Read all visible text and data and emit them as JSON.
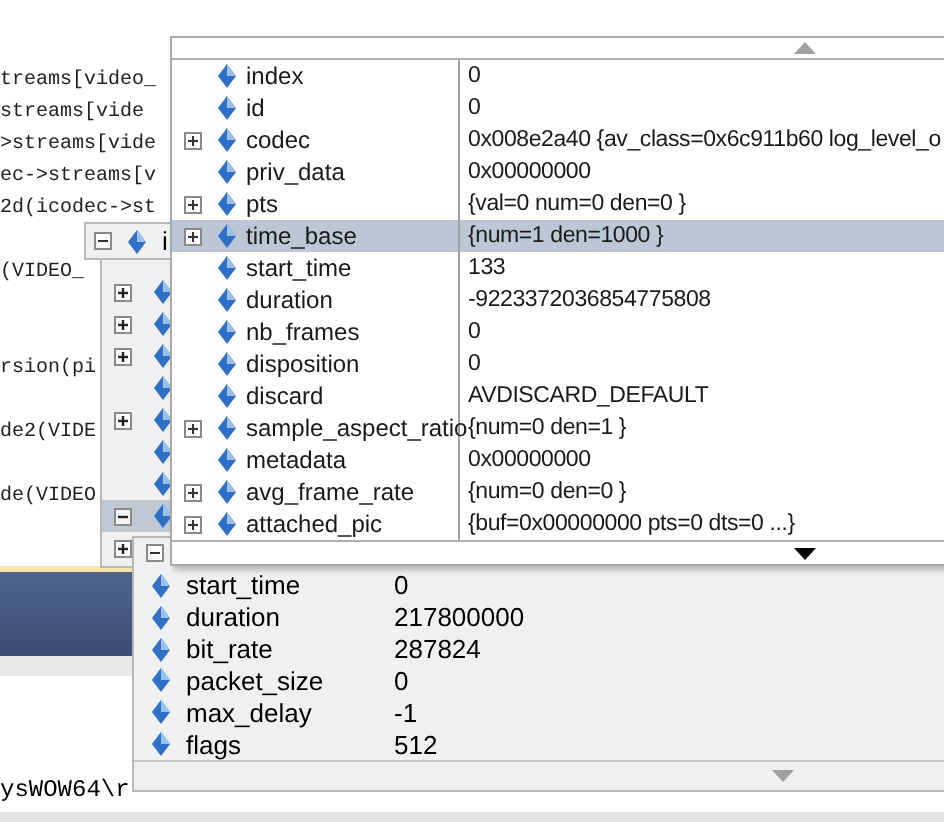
{
  "editor": {
    "lines": [
      {
        "kind": "code",
        "text": "treams[video_"
      },
      {
        "kind": "code",
        "text": "streams[vide"
      },
      {
        "kind": "code",
        "text": ">streams[vide"
      },
      {
        "kind": "code",
        "text": "ec->streams[v"
      },
      {
        "kind": "code",
        "text": "2d(icodec->st"
      },
      {
        "kind": "blank"
      },
      {
        "kind": "code",
        "text": "(VIDEO_"
      },
      {
        "kind": "blank"
      },
      {
        "kind": "blank"
      },
      {
        "kind": "code",
        "text": "rsion(pi"
      },
      {
        "kind": "blank"
      },
      {
        "kind": "code",
        "text": "de2(VIDE"
      },
      {
        "kind": "blank"
      },
      {
        "kind": "code",
        "text": "de(VIDEO"
      }
    ]
  },
  "output": {
    "text": "ysWOW64\\r"
  },
  "outer_tip": {
    "header": {
      "name": "i",
      "expanded": true
    },
    "rows": [
      {
        "expandable": true,
        "expanded": false,
        "selected": false
      },
      {
        "expandable": true,
        "expanded": false,
        "selected": false
      },
      {
        "expandable": true,
        "expanded": false,
        "selected": false
      },
      {
        "expandable": false,
        "selected": false
      },
      {
        "expandable": true,
        "expanded": false,
        "selected": false
      },
      {
        "expandable": false,
        "selected": false
      },
      {
        "expandable": false,
        "selected": false
      },
      {
        "expandable": true,
        "expanded": true,
        "selected": true
      },
      {
        "expandable": true,
        "expanded": false,
        "selected": false
      }
    ]
  },
  "inner_tip": {
    "header": {
      "expanded": true
    },
    "rows": [
      {
        "name": "start_time",
        "value": "0"
      },
      {
        "name": "duration",
        "value": "217800000"
      },
      {
        "name": "bit_rate",
        "value": "287824"
      },
      {
        "name": "packet_size",
        "value": "0"
      },
      {
        "name": "max_delay",
        "value": "-1"
      },
      {
        "name": "flags",
        "value": "512"
      }
    ]
  },
  "front_tip": {
    "rows": [
      {
        "name": "index",
        "value": "0",
        "expandable": false,
        "selected": false
      },
      {
        "name": "id",
        "value": "0",
        "expandable": false,
        "selected": false
      },
      {
        "name": "codec",
        "value": "0x008e2a40 {av_class=0x6c911b60 log_level_o",
        "expandable": true,
        "selected": false
      },
      {
        "name": "priv_data",
        "value": "0x00000000",
        "expandable": false,
        "selected": false
      },
      {
        "name": "pts",
        "value": "{val=0 num=0 den=0 }",
        "expandable": true,
        "selected": false
      },
      {
        "name": "time_base",
        "value": "{num=1 den=1000 }",
        "expandable": true,
        "selected": true
      },
      {
        "name": "start_time",
        "value": "133",
        "expandable": false,
        "selected": false
      },
      {
        "name": "duration",
        "value": "-9223372036854775808",
        "expandable": false,
        "selected": false
      },
      {
        "name": "nb_frames",
        "value": "0",
        "expandable": false,
        "selected": false
      },
      {
        "name": "disposition",
        "value": "0",
        "expandable": false,
        "selected": false
      },
      {
        "name": "discard",
        "value": "AVDISCARD_DEFAULT",
        "expandable": false,
        "selected": false
      },
      {
        "name": "sample_aspect_ratio",
        "value": "{num=0 den=1 }",
        "expandable": true,
        "selected": false
      },
      {
        "name": "metadata",
        "value": "0x00000000",
        "expandable": false,
        "selected": false
      },
      {
        "name": "avg_frame_rate",
        "value": "{num=0 den=0 }",
        "expandable": true,
        "selected": false
      },
      {
        "name": "attached_pic",
        "value": "{buf=0x00000000 pts=0 dts=0 ...}",
        "expandable": true,
        "selected": false
      }
    ]
  }
}
